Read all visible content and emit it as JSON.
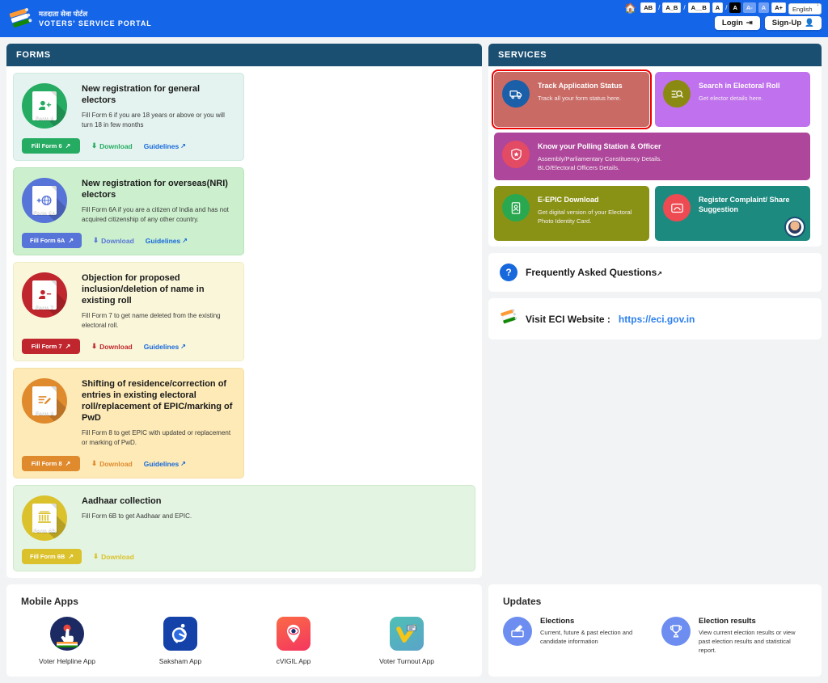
{
  "header": {
    "brand_hi": "मतदाता सेवा पोर्टल",
    "brand_en": "VOTERS' SERVICE PORTAL",
    "home_icon": "home-icon",
    "a11y": [
      {
        "label": "AB",
        "style": "plain"
      },
      {
        "label": "A_B",
        "style": "plain"
      },
      {
        "label": "A__B",
        "style": "plain"
      },
      {
        "label": "A",
        "style": "plain"
      },
      {
        "label": "A",
        "style": "invert"
      },
      {
        "label": "A-",
        "style": "dim"
      },
      {
        "label": "A",
        "style": "dim"
      },
      {
        "label": "A+",
        "style": "plain"
      }
    ],
    "language": "English",
    "login_label": "Login",
    "signup_label": "Sign-Up"
  },
  "forms": {
    "panel_title": "FORMS",
    "cards": [
      {
        "form_tag": "Form 6",
        "title": "New registration for general electors",
        "desc": "Fill Form 6 if you are 18 years or above or you will turn 18 in few months",
        "fill_label": "Fill Form 6",
        "download_label": "Download",
        "guidelines_label": "Guidelines",
        "accent": "#25ab62",
        "bg": "#e4f3ef",
        "border": "#cfe8df",
        "icon": "person-add-icon",
        "has_guidelines": true
      },
      {
        "form_tag": "Form 6A",
        "title": "New registration for overseas(NRI) electors",
        "desc": "Fill Form 6A if you are a citizen of India and has not acquired citizenship of any other country.",
        "fill_label": "Fill Form 6A",
        "download_label": "Download",
        "guidelines_label": "Guidelines",
        "accent": "#5774d8",
        "bg": "#ccf0cd",
        "border": "#b8e4bb",
        "icon": "globe-add-icon",
        "has_guidelines": true
      },
      {
        "form_tag": "Form 7",
        "title": "Objection for proposed inclusion/deletion of name in existing roll",
        "desc": "Fill Form 7 to get name deleted from the existing electoral roll.",
        "fill_label": "Fill Form 7",
        "download_label": "Download",
        "guidelines_label": "Guidelines",
        "accent": "#c0262d",
        "bg": "#faf6d9",
        "border": "#f0ebc5",
        "icon": "person-remove-icon",
        "has_guidelines": true
      },
      {
        "form_tag": "Form 8",
        "title": "Shifting of residence/correction of entries in existing electoral roll/replacement of EPIC/marking of PwD",
        "desc": "Fill Form 8 to get EPIC with updated or replacement or marking of PwD.",
        "fill_label": "Fill Form 8",
        "download_label": "Download",
        "guidelines_label": "Guidelines",
        "accent": "#e08a2e",
        "bg": "#fdeab6",
        "border": "#f5dfa4",
        "icon": "edit-document-icon",
        "has_guidelines": true
      },
      {
        "form_tag": "Form 6B",
        "title": "Aadhaar collection",
        "desc": "Fill Form 6B to get Aadhaar and EPIC.",
        "fill_label": "Fill Form 6B",
        "download_label": "Download",
        "guidelines_label": "",
        "accent": "#dbc12c",
        "bg": "#e3f4e2",
        "border": "#cfe9cd",
        "icon": "aadhaar-card-icon",
        "has_guidelines": false
      }
    ]
  },
  "services": {
    "panel_title": "SERVICES",
    "cards": [
      {
        "title": "Track Application Status",
        "sub1": "Track all your form status here.",
        "sub2": "",
        "bg": "#c96a65",
        "circle": "#1a5fa8",
        "icon": "truck-icon",
        "selected": true,
        "size": "half"
      },
      {
        "title": "Search in Electoral Roll",
        "sub1": "Get elector details here.",
        "sub2": "",
        "bg": "#c071ed",
        "circle": "#8a8a12",
        "icon": "search-list-icon",
        "selected": false,
        "size": "half"
      },
      {
        "title": "Know your Polling Station & Officer",
        "sub1": "Assembly/Parliamentary Constituency Details.",
        "sub2": "BLO/Electoral Officers Details.",
        "bg": "#ae469c",
        "circle": "#e34a63",
        "icon": "shield-star-icon",
        "selected": false,
        "size": "full"
      },
      {
        "title": "E-EPIC Download",
        "sub1": "Get digital version of your Electoral",
        "sub2": "Photo Identity Card.",
        "bg": "#8a9216",
        "circle": "#2aa84f",
        "icon": "id-card-icon",
        "selected": false,
        "size": "half"
      },
      {
        "title": "Register Complaint/ Share Suggestion",
        "sub1": "",
        "sub2": "",
        "bg": "#1d8a80",
        "circle": "#ee4a52",
        "icon": "message-icon",
        "selected": false,
        "size": "half",
        "chat_badge": "chatbot-avatar"
      }
    ]
  },
  "faq": {
    "icon": "question-mark-icon",
    "label": "Frequently Asked Questions"
  },
  "eci": {
    "icon": "eci-logo-icon",
    "label": "Visit ECI Website :",
    "url": "https://eci.gov.in"
  },
  "mobile_apps": {
    "title": "Mobile Apps",
    "items": [
      {
        "label": "Voter Helpline App",
        "icon": "voter-helpline-app-icon"
      },
      {
        "label": "Saksham App",
        "icon": "saksham-app-icon"
      },
      {
        "label": "cVIGIL App",
        "icon": "cvigil-app-icon"
      },
      {
        "label": "Voter Turnout App",
        "icon": "voter-turnout-app-icon"
      }
    ]
  },
  "updates": {
    "title": "Updates",
    "items": [
      {
        "title": "Elections",
        "sub": "Current, future & past election and candidate information",
        "icon": "ballot-box-icon"
      },
      {
        "title": "Election results",
        "sub": "View current election results or view past election results and statistical report.",
        "icon": "trophy-icon"
      }
    ]
  }
}
